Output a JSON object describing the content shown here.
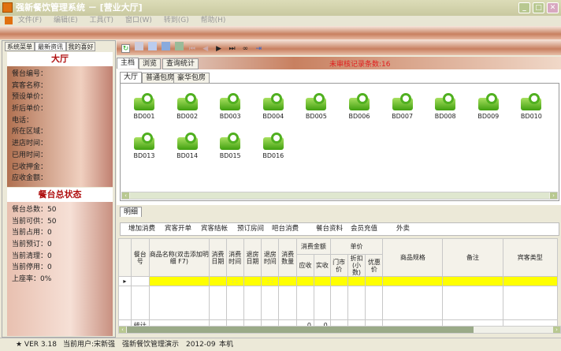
{
  "window": {
    "title": "强新餐饮管理系统 － [营业大厅]"
  },
  "menu": [
    "文件(F)",
    "编辑(E)",
    "工具(T)",
    "窗口(W)",
    "转到(G)",
    "帮助(H)"
  ],
  "left": {
    "tabs": [
      "系统菜单",
      "最新资讯",
      "我的喜好"
    ],
    "hall_title": "大厅",
    "fields": [
      "餐台编号：",
      "宾客名称：",
      "预设单价：",
      "折后单价：",
      "电话：",
      "所在区域：",
      "进店时间：",
      "已用时间：",
      "已收押金：",
      "应收金额："
    ],
    "status_title": "餐台总状态",
    "stats": [
      "餐台总数：50",
      "当前可供：50",
      "当前占用：0",
      "当前预订：0",
      "当前清理：0",
      "当前停用：0",
      "上座率：0%"
    ]
  },
  "main": {
    "tabs": [
      "主档",
      "浏览",
      "查询统计"
    ],
    "unaudited": "未审核记录条数:16",
    "room_tabs": [
      "大厅",
      "普通包房",
      "豪华包房"
    ],
    "rooms": [
      "BD001",
      "BD002",
      "BD003",
      "BD004",
      "BD005",
      "BD006",
      "BD007",
      "BD008",
      "BD009",
      "BD010",
      "BD013",
      "BD014",
      "BD015",
      "BD016"
    ],
    "detail_tab": "明细",
    "detail_buttons": [
      "增加消费",
      "宾客开单",
      "宾客结帐",
      "预订房间",
      "吧台消费",
      "餐台资料",
      "会员充值",
      "外卖"
    ],
    "columns": {
      "table_no": "餐台号",
      "item_name": "商品名称(双击添加明细 F7)",
      "cons_date": "消费日期",
      "cons_time": "消费时间",
      "out_date": "退房日期",
      "out_time": "退房时间",
      "qty": "消费数量",
      "amount": "消费金额",
      "receivable": "应收",
      "received": "实收",
      "unit_price": "单价",
      "retail": "门市价",
      "discount": "折扣(小数)",
      "special": "优惠价",
      "spec": "商品规格",
      "remark": "备注",
      "guest_type": "宾客类型"
    },
    "row_time_placeholder": ": :",
    "total_label": "统计",
    "total_receivable": "0",
    "total_received": "0"
  },
  "statusbar": {
    "version": "★ VER 3.18",
    "user": "当前用户:宋新强",
    "company": "强新餐饮管理演示",
    "date": "2012-09",
    "host": "本机"
  }
}
